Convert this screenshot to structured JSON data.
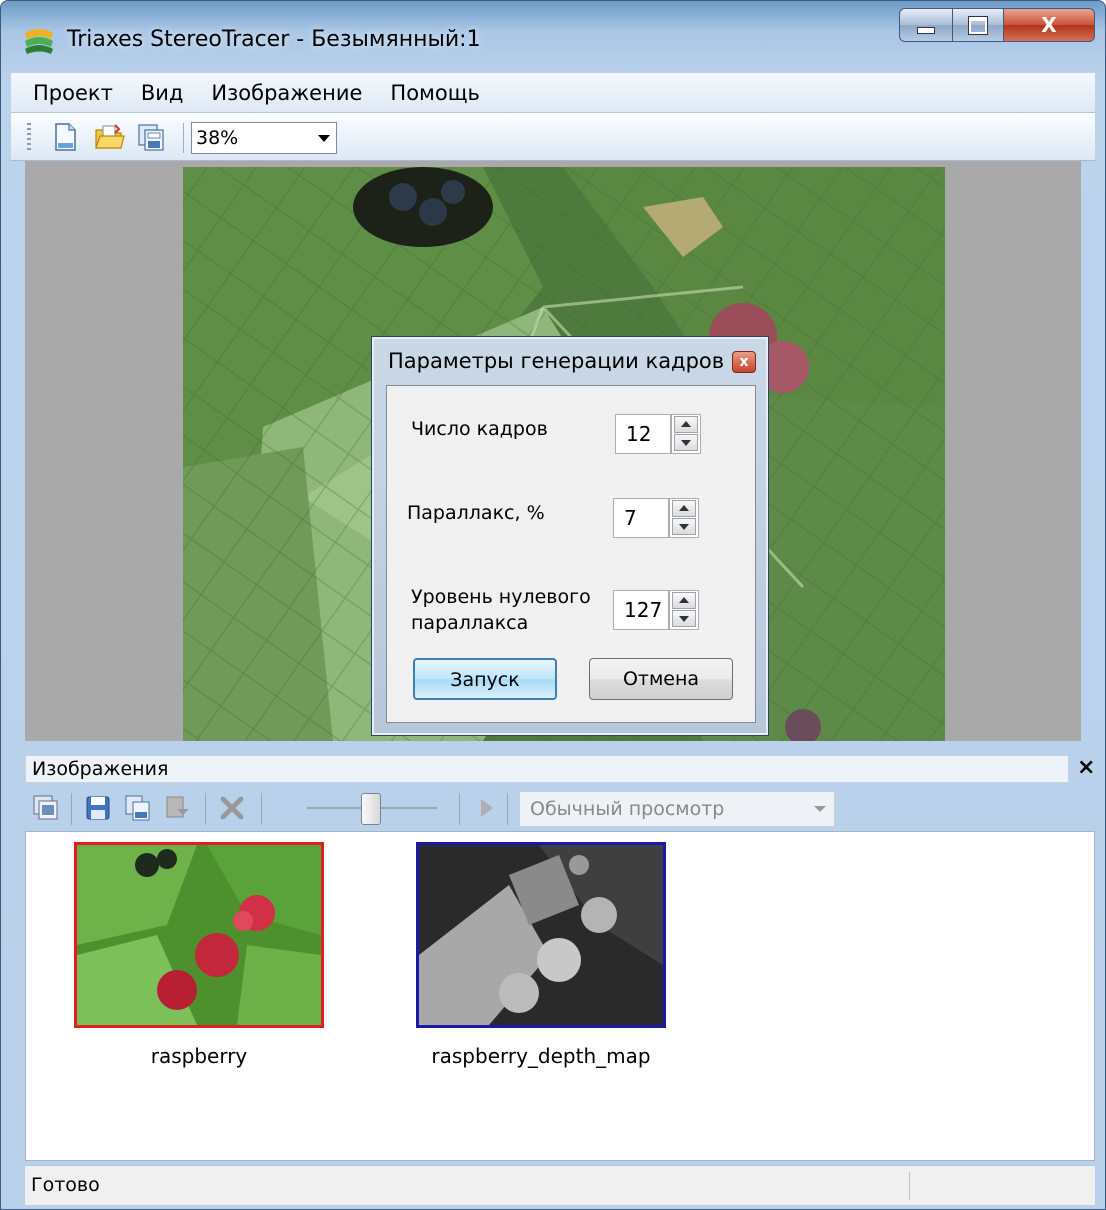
{
  "window": {
    "title": "Triaxes StereoTracer - Безымянный:1",
    "close_glyph": "X"
  },
  "menubar": {
    "items": [
      "Проект",
      "Вид",
      "Изображение",
      "Помощь"
    ]
  },
  "toolbar": {
    "icons": [
      "new-document-icon",
      "open-folder-icon",
      "save-copy-icon"
    ],
    "zoom_value": "38%"
  },
  "dialog": {
    "title": "Параметры генерации кадров",
    "close_glyph": "x",
    "frames_label": "Число кадров",
    "frames_value": "12",
    "parallax_label": "Параллакс, %",
    "parallax_value": "7",
    "zero_parallax_label_line1": "Уровень нулевого",
    "zero_parallax_label_line2": "параллакса",
    "zero_parallax_value": "127",
    "start_button": "Запуск",
    "cancel_button": "Отмена"
  },
  "images_panel": {
    "title": "Изображения",
    "close_glyph": "×",
    "view_mode": "Обычный просмотр",
    "thumbnails": [
      {
        "label": "raspberry",
        "border_color": "#e02020"
      },
      {
        "label": "raspberry_depth_map",
        "border_color": "#1a1aa8"
      }
    ]
  },
  "status": {
    "text": "Готово"
  }
}
